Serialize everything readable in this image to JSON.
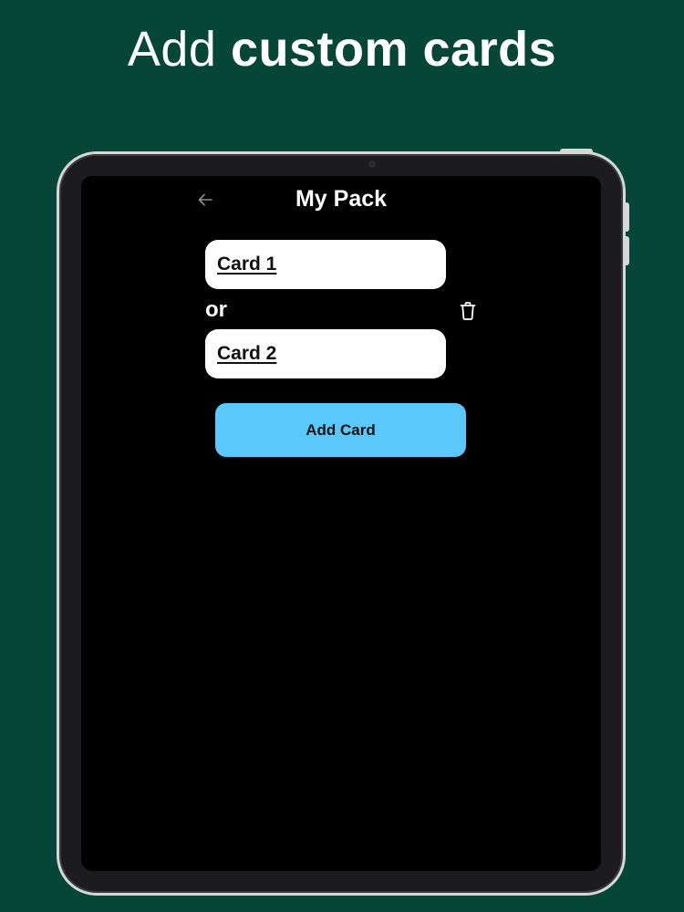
{
  "headline": {
    "regular": "Add ",
    "bold": "custom cards"
  },
  "nav": {
    "back_icon": "arrow-left-icon",
    "title": "My Pack"
  },
  "pair": {
    "card1_value": "Card 1",
    "separator": "or",
    "card2_value": "Card 2",
    "delete_icon": "trash-icon"
  },
  "actions": {
    "add_card_label": "Add Card"
  },
  "colors": {
    "background": "#064636",
    "screen": "#000000",
    "accent": "#5ac8fa",
    "field": "#ffffff"
  }
}
